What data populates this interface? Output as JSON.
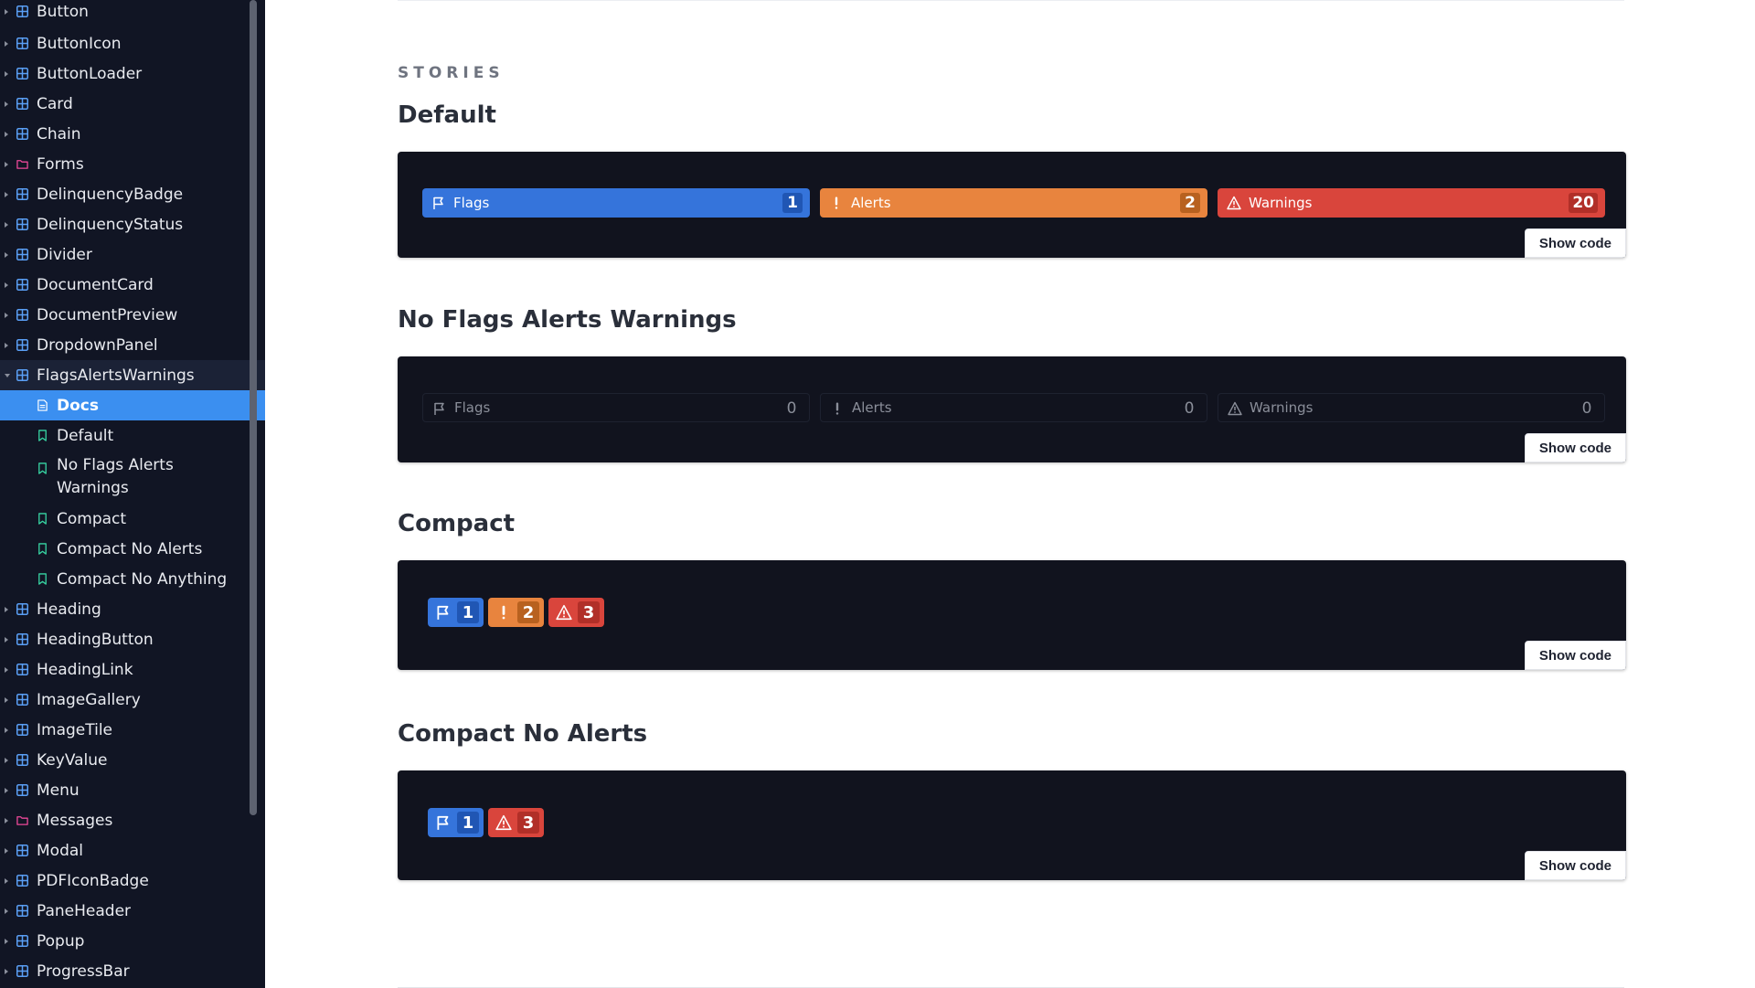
{
  "sidebar": {
    "items": [
      {
        "label": "Button",
        "icon": "component-icon"
      },
      {
        "label": "ButtonIcon",
        "icon": "component-icon"
      },
      {
        "label": "ButtonLoader",
        "icon": "component-icon"
      },
      {
        "label": "Card",
        "icon": "component-icon"
      },
      {
        "label": "Chain",
        "icon": "component-icon"
      },
      {
        "label": "Forms",
        "icon": "folder-icon"
      },
      {
        "label": "DelinquencyBadge",
        "icon": "component-icon"
      },
      {
        "label": "DelinquencyStatus",
        "icon": "component-icon"
      },
      {
        "label": "Divider",
        "icon": "component-icon"
      },
      {
        "label": "DocumentCard",
        "icon": "component-icon"
      },
      {
        "label": "DocumentPreview",
        "icon": "component-icon"
      },
      {
        "label": "DropdownPanel",
        "icon": "component-icon"
      },
      {
        "label": "FlagsAlertsWarnings",
        "icon": "component-icon"
      },
      {
        "label": "Docs",
        "icon": "document-icon"
      },
      {
        "label": "Default",
        "icon": "bookmark-icon"
      },
      {
        "label": "No Flags Alerts Warnings",
        "icon": "bookmark-icon"
      },
      {
        "label": "Compact",
        "icon": "bookmark-icon"
      },
      {
        "label": "Compact No Alerts",
        "icon": "bookmark-icon"
      },
      {
        "label": "Compact No Anything",
        "icon": "bookmark-icon"
      },
      {
        "label": "Heading",
        "icon": "component-icon"
      },
      {
        "label": "HeadingButton",
        "icon": "component-icon"
      },
      {
        "label": "HeadingLink",
        "icon": "component-icon"
      },
      {
        "label": "ImageGallery",
        "icon": "component-icon"
      },
      {
        "label": "ImageTile",
        "icon": "component-icon"
      },
      {
        "label": "KeyValue",
        "icon": "component-icon"
      },
      {
        "label": "Menu",
        "icon": "component-icon"
      },
      {
        "label": "Messages",
        "icon": "folder-icon"
      },
      {
        "label": "Modal",
        "icon": "component-icon"
      },
      {
        "label": "PDFIconBadge",
        "icon": "component-icon"
      },
      {
        "label": "PaneHeader",
        "icon": "component-icon"
      },
      {
        "label": "Popup",
        "icon": "component-icon"
      },
      {
        "label": "ProgressBar",
        "icon": "component-icon"
      }
    ]
  },
  "main": {
    "stories_label": "STORIES",
    "show_code_label": "Show code",
    "stories": [
      {
        "title": "Default",
        "flags_label": "Flags",
        "flags_count": "1",
        "alerts_label": "Alerts",
        "alerts_count": "2",
        "warnings_label": "Warnings",
        "warnings_count": "20"
      },
      {
        "title": "No Flags Alerts Warnings",
        "flags_label": "Flags",
        "flags_count": "0",
        "alerts_label": "Alerts",
        "alerts_count": "0",
        "warnings_label": "Warnings",
        "warnings_count": "0"
      },
      {
        "title": "Compact",
        "flags_count": "1",
        "alerts_count": "2",
        "warnings_count": "3"
      },
      {
        "title": "Compact No Alerts",
        "flags_count": "1",
        "warnings_count": "3"
      }
    ]
  },
  "colors": {
    "sidebar_bg": "#111524",
    "selected": "#3b8ff0",
    "flags": "#3574db",
    "alerts": "#e8843e",
    "warnings": "#d9453c",
    "canvas": "#11131e"
  }
}
